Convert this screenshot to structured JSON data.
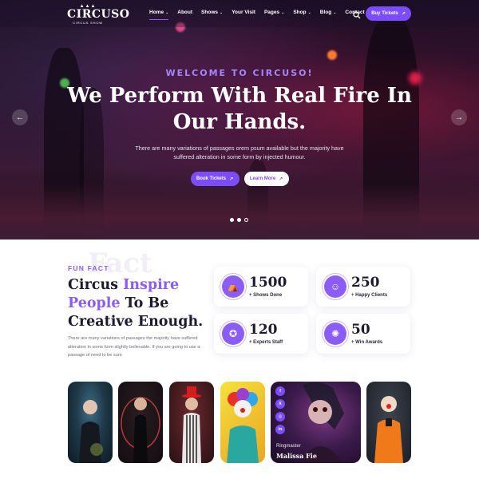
{
  "brand": {
    "name": "CIRCUSO",
    "tagline": "CIRCUS SHOW"
  },
  "nav": {
    "items": [
      {
        "label": "Home",
        "dropdown": true,
        "active": true
      },
      {
        "label": "About",
        "dropdown": false
      },
      {
        "label": "Shows",
        "dropdown": true
      },
      {
        "label": "Your Visit",
        "dropdown": false
      },
      {
        "label": "Pages",
        "dropdown": true
      },
      {
        "label": "Shop",
        "dropdown": true
      },
      {
        "label": "Blog",
        "dropdown": true
      },
      {
        "label": "Contact",
        "dropdown": false
      }
    ],
    "buy_label": "Buy Tickets"
  },
  "hero": {
    "kicker": "WELCOME TO CIRCUSO!",
    "title_line1": "We Perform With Real Fire In",
    "title_line2": "Our Hands.",
    "description_line1": "There are many variations of passages orem psum available but the majority have",
    "description_line2": "suffered alteration in some form by injected humour.",
    "primary_button": "Book Tickets",
    "secondary_button": "Learn More",
    "slides": 3,
    "active_slide": 1
  },
  "funfact": {
    "watermark": "Fact",
    "label": "FUN FACT",
    "title_part1": "Circus ",
    "title_highlight": "Inspire People",
    "title_part2": " To Be Creative Enough.",
    "description": "There are many variations of passages the majority have suffered alteration in some form slightly believable. If you are going to use a passage of need to be sure.",
    "stats": [
      {
        "value": "1500",
        "label": "+ Shows Done",
        "icon": "tent-icon"
      },
      {
        "value": "250",
        "label": "+ Happy Clients",
        "icon": "people-icon"
      },
      {
        "value": "120",
        "label": "+ Experts Staff",
        "icon": "staff-icon"
      },
      {
        "value": "50",
        "label": "+ Win Awards",
        "icon": "award-icon"
      }
    ]
  },
  "team": {
    "featured": {
      "role": "Ringmaster",
      "name": "Malissa Fie"
    },
    "socials": [
      "f",
      "X",
      "◎",
      "in"
    ]
  },
  "colors": {
    "accent": "#7c4dff",
    "accent_light": "#8b5cf6",
    "dark": "#1d1b2e"
  }
}
